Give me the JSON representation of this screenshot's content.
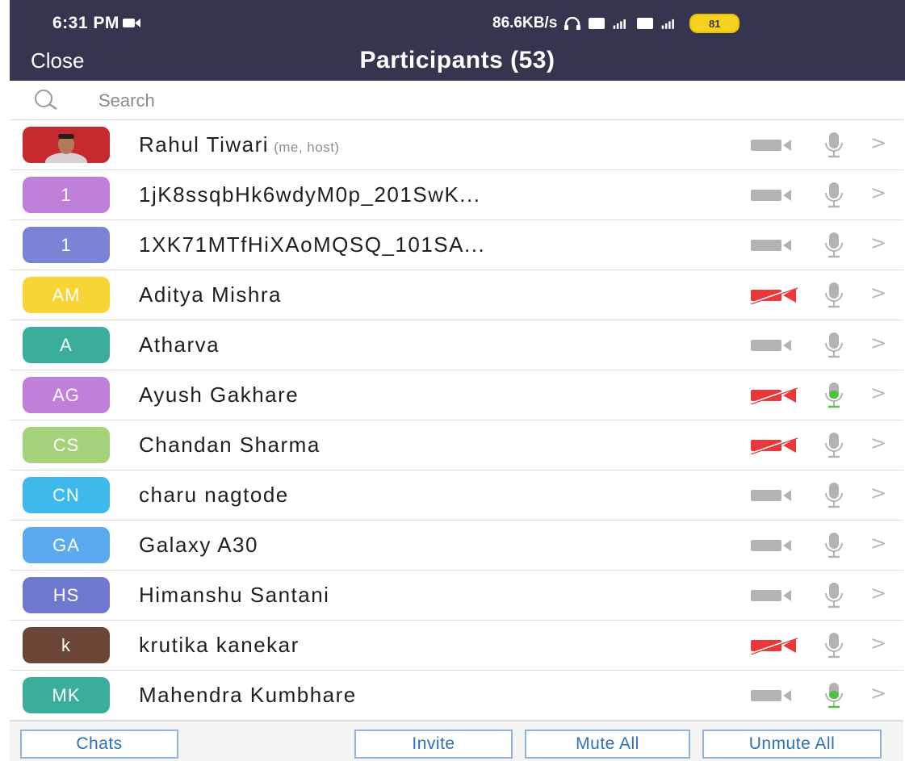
{
  "status_bar": {
    "time": "6:31 PM",
    "network_speed": "86.6KB/s",
    "battery": "81"
  },
  "header": {
    "close_label": "Close",
    "title": "Participants (53)"
  },
  "search": {
    "placeholder": "Search"
  },
  "colors": {
    "header_bg": "#35354f",
    "video_off_red": "#e8383a",
    "unmuted_green": "#4fc23f",
    "muted_gray": "#b3b3b3",
    "button_blue": "#2f6fb9"
  },
  "participants": [
    {
      "initials": "",
      "avatar_type": "photo",
      "avatar_color": "#c62a2e",
      "name": "Rahul Tiwari",
      "role": "(me, host)",
      "video_on": true,
      "mic_active": false
    },
    {
      "initials": "1",
      "avatar_type": "initials",
      "avatar_color": "#c07fd9",
      "name": "1jK8ssqbHk6wdyM0p_201SwK...",
      "role": "",
      "video_on": true,
      "mic_active": false
    },
    {
      "initials": "1",
      "avatar_type": "initials",
      "avatar_color": "#7a83d4",
      "name": "1XK71MTfHiXAoMQSQ_101SA...",
      "role": "",
      "video_on": true,
      "mic_active": false
    },
    {
      "initials": "AM",
      "avatar_type": "initials",
      "avatar_color": "#f7d535",
      "name": "Aditya Mishra",
      "role": "",
      "video_on": false,
      "mic_active": false
    },
    {
      "initials": "A",
      "avatar_type": "initials",
      "avatar_color": "#3bad9b",
      "name": "Atharva",
      "role": "",
      "video_on": true,
      "mic_active": false
    },
    {
      "initials": "AG",
      "avatar_type": "initials",
      "avatar_color": "#c07fd9",
      "name": "Ayush Gakhare",
      "role": "",
      "video_on": false,
      "mic_active": true
    },
    {
      "initials": "CS",
      "avatar_type": "initials",
      "avatar_color": "#a7d27c",
      "name": "Chandan Sharma",
      "role": "",
      "video_on": false,
      "mic_active": false
    },
    {
      "initials": "CN",
      "avatar_type": "initials",
      "avatar_color": "#3fb9ec",
      "name": "charu nagtode",
      "role": "",
      "video_on": true,
      "mic_active": false
    },
    {
      "initials": "GA",
      "avatar_type": "initials",
      "avatar_color": "#5ba9ee",
      "name": "Galaxy A30",
      "role": "",
      "video_on": true,
      "mic_active": false
    },
    {
      "initials": "HS",
      "avatar_type": "initials",
      "avatar_color": "#6f78cf",
      "name": "Himanshu Santani",
      "role": "",
      "video_on": true,
      "mic_active": false
    },
    {
      "initials": "k",
      "avatar_type": "initials",
      "avatar_color": "#6b4536",
      "name": "krutika kanekar",
      "role": "",
      "video_on": false,
      "mic_active": false
    },
    {
      "initials": "MK",
      "avatar_type": "initials",
      "avatar_color": "#3bad9b",
      "name": "Mahendra Kumbhare",
      "role": "",
      "video_on": true,
      "mic_active": true
    }
  ],
  "footer": {
    "chats_label": "Chats",
    "invite_label": "Invite",
    "mute_all_label": "Mute All",
    "unmute_all_label": "Unmute All"
  }
}
